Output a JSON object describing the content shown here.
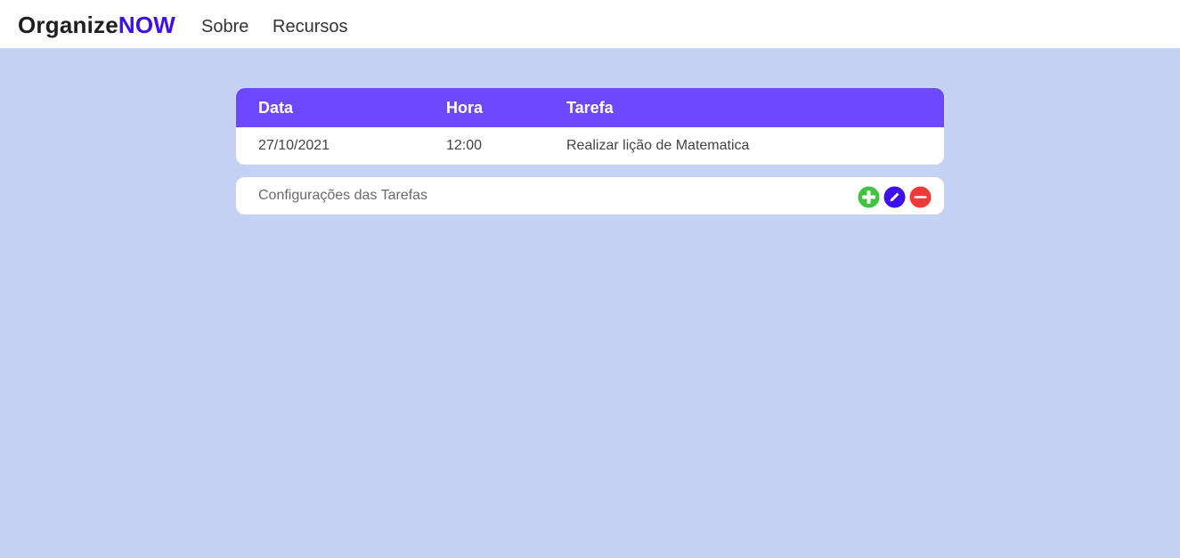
{
  "navbar": {
    "brand_main": "Organize",
    "brand_accent": "NOW",
    "links": [
      {
        "label": "Sobre"
      },
      {
        "label": "Recursos"
      }
    ]
  },
  "table": {
    "headers": {
      "data": "Data",
      "hora": "Hora",
      "tarefa": "Tarefa"
    },
    "rows": [
      {
        "data": "27/10/2021",
        "hora": "12:00",
        "tarefa": "Realizar lição de Matematica"
      }
    ]
  },
  "settings": {
    "label": "Configurações das Tarefas",
    "actions": [
      {
        "icon": "plus-icon",
        "color": "#3ec43e"
      },
      {
        "icon": "pencil-icon",
        "color": "#3d0ff0"
      },
      {
        "icon": "minus-icon",
        "color": "#ef3a3a"
      }
    ]
  },
  "colors": {
    "background": "#c5d2f5",
    "brand_accent": "#3d0ff0",
    "table_header": "#6e48ff"
  }
}
